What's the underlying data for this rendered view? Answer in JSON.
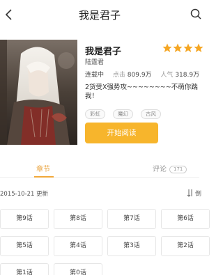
{
  "header": {
    "title": "我是君子"
  },
  "book": {
    "title": "我是君子",
    "author": "陆霆君",
    "status": "连载中",
    "clicks_label": "点击",
    "clicks_value": "809.9万",
    "popularity_label": "人气",
    "popularity_value": "318.9万",
    "summary_line1": "2货受X强势攻~~~~~~~~不萌你踹",
    "summary_line2": "我！",
    "rating_stars": 4,
    "tags": [
      "彩虹",
      "魔幻",
      "古风"
    ],
    "read_button_label": "开始阅读",
    "star_color": "#f5a623",
    "accent_color": "#f7b52c"
  },
  "tabs": {
    "chapters_label": "章节",
    "comments_label": "评论",
    "comments_count": "171"
  },
  "chapter_list": {
    "updated": "2015-10-21 更新",
    "sort_label": "倒"
  },
  "chapters": [
    "第9话",
    "第8话",
    "第7话",
    "第6话",
    "第5话",
    "第4话",
    "第3话",
    "第2话",
    "第1话",
    "第0话"
  ]
}
